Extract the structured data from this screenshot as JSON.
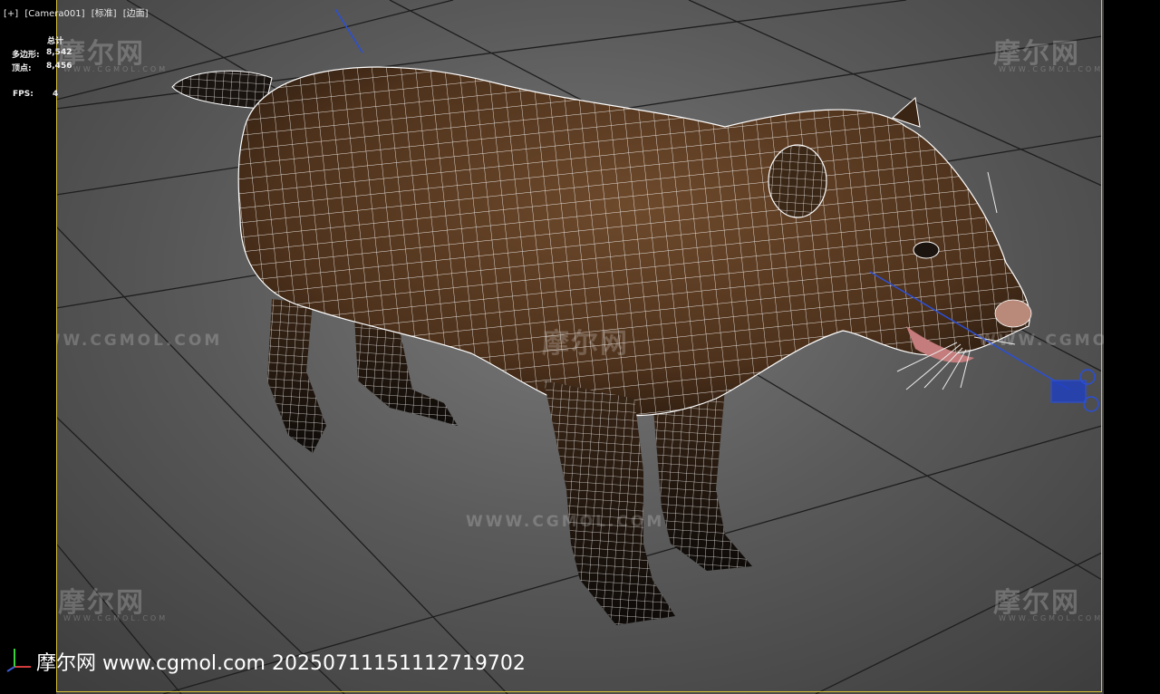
{
  "viewport": {
    "label_parts": [
      "[+]",
      "[Camera001]",
      "[标准]",
      "[边面]"
    ]
  },
  "stats": {
    "total_label": "总计",
    "polygons_label": "多边形:",
    "polygons_value": "8,542",
    "vertices_label": "顶点:",
    "vertices_value": "8,456",
    "fps_label": "FPS:",
    "fps_value": "4"
  },
  "watermarks": {
    "brand": "摩尔网",
    "sub": "WWW.CGMOL.COM",
    "mid": "WWW.CGMOL.COM"
  },
  "footer": {
    "text": "摩尔网 www.cgmol.com 20250711151112719702"
  },
  "colors": {
    "frame_border": "#d8c23a",
    "grid_line": "#1e1e1e",
    "fur": "#5b3b22",
    "wire": "#ffffff",
    "camera": "#2a4fd8"
  }
}
